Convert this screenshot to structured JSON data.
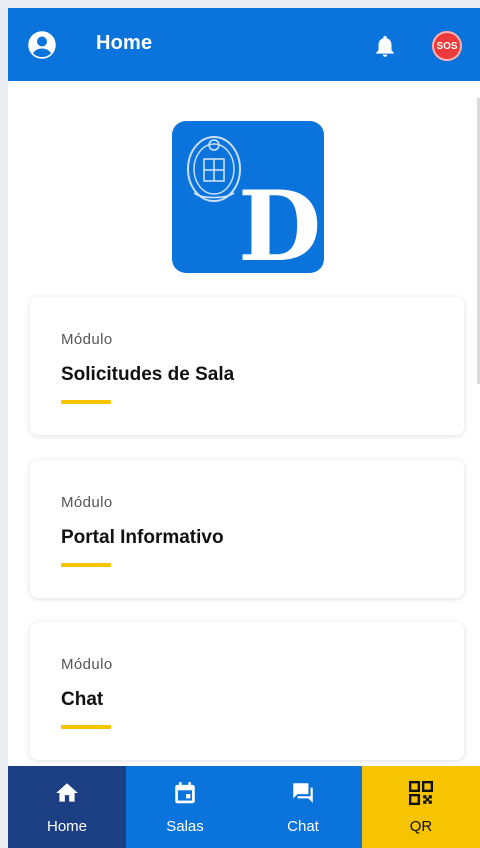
{
  "header": {
    "title": "Home",
    "account_icon": "account-circle-icon",
    "notifications_icon": "bell-icon",
    "sos_label": "SOS"
  },
  "logo": {
    "letter": "D"
  },
  "modules": [
    {
      "kicker": "Módulo",
      "name": "Solicitudes de Sala"
    },
    {
      "kicker": "Módulo",
      "name": "Portal Informativo"
    },
    {
      "kicker": "Módulo",
      "name": "Chat"
    }
  ],
  "bottom_nav": [
    {
      "label": "Home",
      "icon": "home-icon",
      "active": true
    },
    {
      "label": "Salas",
      "icon": "calendar-icon",
      "active": false
    },
    {
      "label": "Chat",
      "icon": "chat-icon",
      "active": false
    },
    {
      "label": "QR",
      "icon": "qr-code-icon",
      "active": false
    }
  ],
  "colors": {
    "primary": "#0a74dc",
    "nav_active": "#1b3f82",
    "accent": "#f6c400",
    "sos": "#ec3a3a"
  }
}
